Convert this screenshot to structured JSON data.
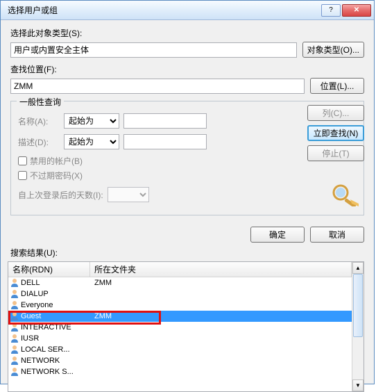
{
  "title": "选择用户或组",
  "labels": {
    "object_type": "选择此对象类型(S):",
    "object_type_value": "用户或内置安全主体",
    "object_type_btn": "对象类型(O)...",
    "location": "查找位置(F):",
    "location_value": "ZMM",
    "location_btn": "位置(L)...",
    "general_query": "一般性查询",
    "name": "名称(A):",
    "desc": "描述(D):",
    "starts_with": "起始为",
    "disabled_acct": "禁用的帐户(B)",
    "no_expire_pw": "不过期密码(X)",
    "days_since_login": "自上次登录后的天数(I):",
    "columns_btn": "列(C)...",
    "findnow_btn": "立即查找(N)",
    "stop_btn": "停止(T)",
    "ok_btn": "确定",
    "cancel_btn": "取消",
    "results": "搜索结果(U):",
    "col_rdn": "名称(RDN)",
    "col_folder": "所在文件夹"
  },
  "results": [
    {
      "name": "DELL",
      "folder": "ZMM"
    },
    {
      "name": "DIALUP",
      "folder": ""
    },
    {
      "name": "Everyone",
      "folder": ""
    },
    {
      "name": "Guest",
      "folder": "ZMM",
      "selected": true
    },
    {
      "name": "INTERACTIVE",
      "folder": ""
    },
    {
      "name": "IUSR",
      "folder": ""
    },
    {
      "name": "LOCAL SER...",
      "folder": ""
    },
    {
      "name": "NETWORK",
      "folder": ""
    },
    {
      "name": "NETWORK S...",
      "folder": ""
    }
  ]
}
